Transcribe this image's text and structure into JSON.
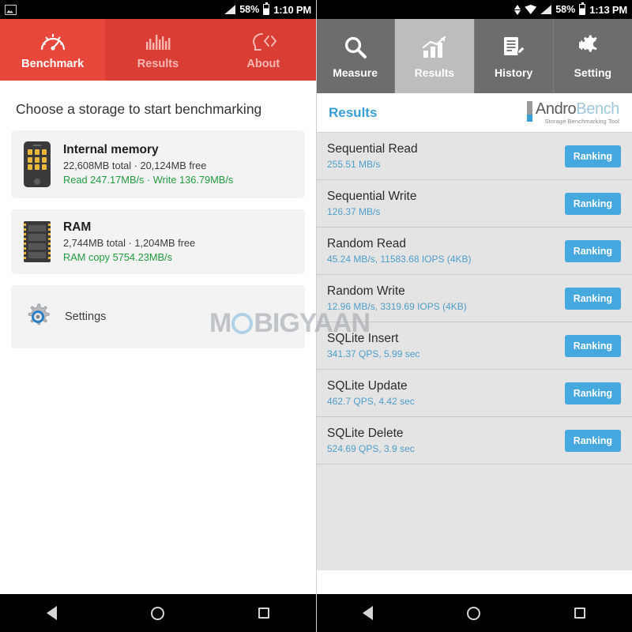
{
  "left": {
    "statusbar": {
      "notification_icon": "photo-icon",
      "signal_icon": "signal-icon",
      "battery_percent": "58%",
      "battery_icon": "battery-icon",
      "time": "1:10 PM"
    },
    "tabs": [
      {
        "label": "Benchmark",
        "icon": "speedometer-icon",
        "selected": true
      },
      {
        "label": "Results",
        "icon": "bar-chart-icon",
        "selected": false
      },
      {
        "label": "About",
        "icon": "head-code-icon",
        "selected": false
      }
    ],
    "title": "Choose a storage to start benchmarking",
    "cards": [
      {
        "icon": "phone-storage-icon",
        "name": "Internal memory",
        "capacity": "22,608MB total · 20,124MB free",
        "speed": "Read 247.17MB/s · Write 136.79MB/s"
      },
      {
        "icon": "ram-module-icon",
        "name": "RAM",
        "capacity": "2,744MB total · 1,204MB free",
        "speed": "RAM copy 5754.23MB/s"
      }
    ],
    "settings": {
      "icon": "gear-icon",
      "label": "Settings"
    },
    "navbar": {
      "back": "back-icon",
      "home": "home-icon",
      "recents": "recents-icon"
    }
  },
  "right": {
    "statusbar": {
      "sync_icon": "sync-icon",
      "wifi_icon": "wifi-icon",
      "signal_icon": "signal-icon",
      "battery_percent": "58%",
      "battery_icon": "battery-icon",
      "time": "1:13 PM"
    },
    "tabs": [
      {
        "label": "Measure",
        "icon": "magnifier-icon",
        "selected": false
      },
      {
        "label": "Results",
        "icon": "growth-chart-icon",
        "selected": true
      },
      {
        "label": "History",
        "icon": "document-pencil-icon",
        "selected": false
      },
      {
        "label": "Setting",
        "icon": "gears-icon",
        "selected": false
      }
    ],
    "header": {
      "title": "Results",
      "logo_main_a": "Andro",
      "logo_main_b": "Bench",
      "logo_sub": "Storage Benchmarking Tool"
    },
    "rows": [
      {
        "name": "Sequential Read",
        "value": "255.51 MB/s",
        "button": "Ranking"
      },
      {
        "name": "Sequential Write",
        "value": "126.37 MB/s",
        "button": "Ranking"
      },
      {
        "name": "Random Read",
        "value": "45.24 MB/s, 11583.68 IOPS (4KB)",
        "button": "Ranking"
      },
      {
        "name": "Random Write",
        "value": "12.96 MB/s, 3319.69 IOPS (4KB)",
        "button": "Ranking"
      },
      {
        "name": "SQLite Insert",
        "value": "341.37 QPS, 5.99 sec",
        "button": "Ranking"
      },
      {
        "name": "SQLite Update",
        "value": "462.7 QPS, 4.42 sec",
        "button": "Ranking"
      },
      {
        "name": "SQLite Delete",
        "value": "524.69 QPS, 3.9 sec",
        "button": "Ranking"
      }
    ],
    "navbar": {
      "back": "back-icon",
      "home": "home-icon",
      "recents": "recents-icon"
    }
  },
  "watermark": {
    "part1": "M",
    "part2": "BIGYAAN"
  },
  "colors": {
    "accent_red": "#d93d33",
    "accent_red_selected": "#e8473c",
    "tab_grey": "#6d6d6d",
    "tab_grey_selected": "#bdbdbd",
    "link_blue": "#3a9fd4",
    "button_blue": "#45a8de",
    "speed_green": "#239b3f",
    "list_bg": "#e4e4e4"
  }
}
